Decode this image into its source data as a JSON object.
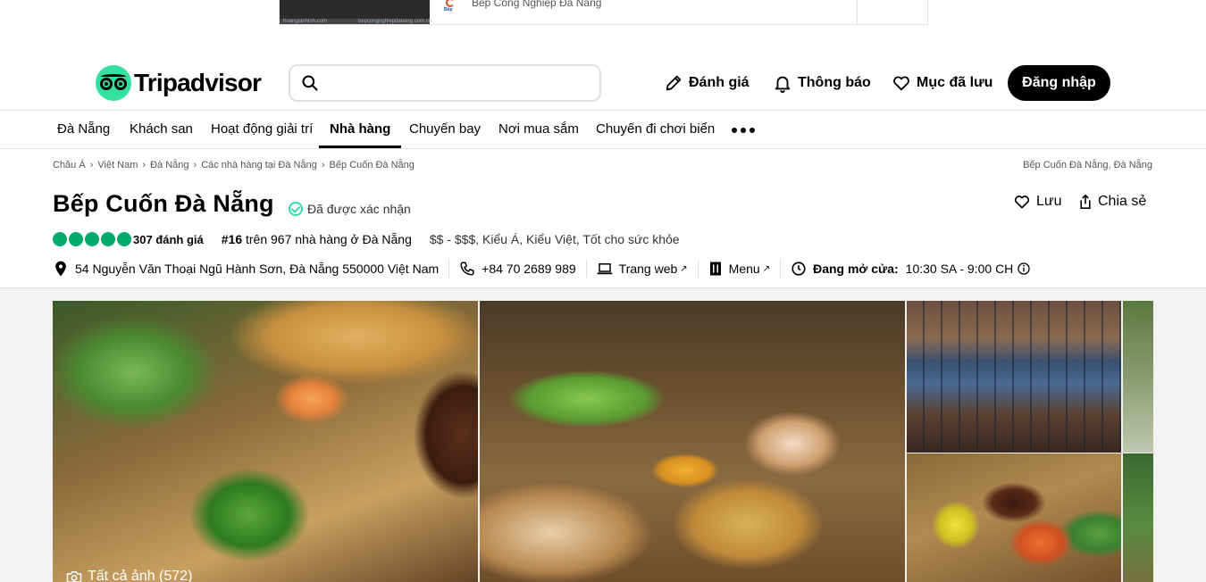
{
  "ad": {
    "text": "Bếp Công Nghiệp Đà Nẵng",
    "img_text_left": "hoangianhinh.com",
    "img_text_right": "bepcongnghiepdanang.com.vn",
    "logo_text": "Bếp"
  },
  "header": {
    "brand": "Tripadvisor",
    "search_placeholder": "",
    "review": "Đánh giá",
    "notifications": "Thông báo",
    "saved": "Mục đã lưu",
    "login": "Đăng nhập"
  },
  "catnav": {
    "items": [
      "Đà Nẵng",
      "Khách san",
      "Hoạt động giải trí",
      "Nhà hàng",
      "Chuyến bay",
      "Nơi mua sắm",
      "Chuyến đi chơi biển"
    ],
    "active_index": 3
  },
  "breadcrumb": {
    "items": [
      "Châu Á",
      "Việt Nam",
      "Đà Nẵng",
      "Các nhà hàng tại Đà Nẵng",
      "Bếp Cuốn Đà Nẵng"
    ],
    "right": "Bếp Cuốn Đà Nẵng, Đà Nẵng"
  },
  "restaurant": {
    "name": "Bếp Cuốn Đà Nẵng",
    "verified": "Đã được xác nhận",
    "rating": 5,
    "reviews": "307 đánh giá",
    "rank_num": "#16",
    "rank_text": " trên 967 nhà hàng ở Đà Nẵng",
    "cuisine": "$$ - $$$, Kiểu Á, Kiểu Việt, Tốt cho sức khỏe",
    "address": "54 Nguyễn Văn Thoại Ngũ Hành Sơn, Đà Nẵng 550000 Việt Nam",
    "phone": "+84 70 2689 989",
    "website": "Trang web",
    "menu": "Menu",
    "hours_label": "Đang mở cửa:",
    "hours": "10:30 SA - 9:00 CH",
    "save": "Lưu",
    "share": "Chia sẻ"
  },
  "gallery": {
    "all_photos": "Tất cả ảnh (572)"
  },
  "colors": {
    "brand_green": "#34e0a1",
    "rating_green": "#00aa6c",
    "black": "#000000"
  }
}
